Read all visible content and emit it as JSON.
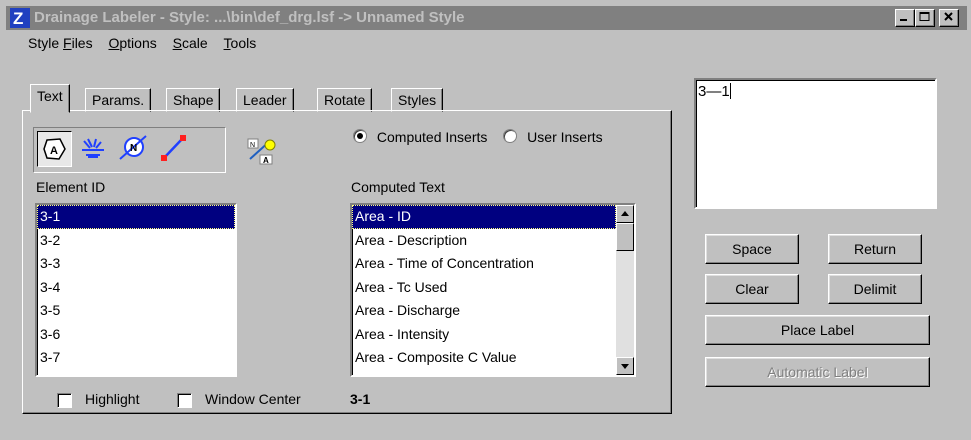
{
  "window": {
    "title": "Drainage Labeler - Style: ...\\bin\\def_drg.lsf -> Unnamed Style"
  },
  "menu": [
    {
      "label": "Style Files"
    },
    {
      "label": "Options"
    },
    {
      "label": "Scale"
    },
    {
      "label": "Tools"
    }
  ],
  "tabs": [
    {
      "label": "Text",
      "active": true
    },
    {
      "label": "Params.",
      "active": false
    },
    {
      "label": "Shape",
      "active": false
    },
    {
      "label": "Leader",
      "active": false
    },
    {
      "label": "Rotate",
      "active": false
    },
    {
      "label": "Styles",
      "active": false
    }
  ],
  "toolbar": {
    "icons": [
      "area-label-icon",
      "inlet-icon",
      "node-icon",
      "link-icon"
    ],
    "extra_icon": "key-label-icon"
  },
  "insert_mode": {
    "options": [
      "Computed Inserts",
      "User Inserts"
    ],
    "selected": "Computed Inserts"
  },
  "element_id": {
    "label": "Element ID",
    "items": [
      "3-1",
      "3-2",
      "3-3",
      "3-4",
      "3-5",
      "3-6",
      "3-7"
    ],
    "selected": "3-1"
  },
  "computed_text": {
    "label": "Computed Text",
    "items": [
      "Area - ID",
      "Area - Description",
      "Area - Time of Concentration",
      "Area - Tc Used",
      "Area - Discharge",
      "Area - Intensity",
      "Area - Composite C Value"
    ],
    "selected": "Area - ID"
  },
  "options": {
    "highlight_label": "Highlight",
    "highlight_checked": false,
    "window_center_label": "Window Center",
    "window_center_checked": false,
    "current_element": "3-1"
  },
  "label_text": {
    "value": "3—1"
  },
  "buttons": {
    "space": "Space",
    "return": "Return",
    "clear": "Clear",
    "delimit": "Delimit",
    "place_label": "Place Label",
    "automatic_label": "Automatic Label"
  },
  "colors": {
    "titlebar_inactive": "#808080",
    "selection": "#000080",
    "face": "#c0c0c0"
  }
}
